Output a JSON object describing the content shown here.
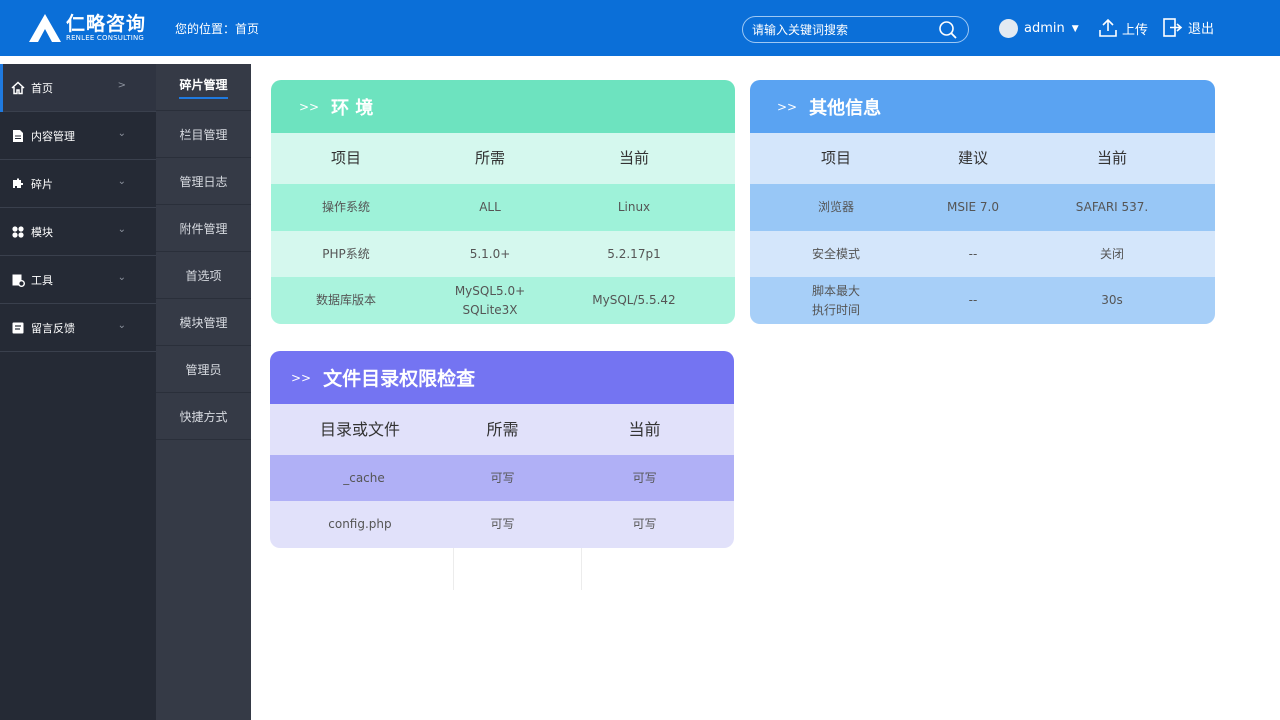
{
  "header": {
    "logo_main": "仁略咨询",
    "logo_sub": "RENLEE CONSULTING",
    "breadcrumb_label": "您的位置：",
    "breadcrumb_page": "首页",
    "search_placeholder": "请输入关键词搜索",
    "username": "admin",
    "upload_label": "上传",
    "logout_label": "退出",
    "brand_color": "#0b6fd8"
  },
  "sidebar": {
    "items": [
      {
        "label": "首页",
        "icon": "home-icon",
        "active": true
      },
      {
        "label": "内容管理",
        "icon": "document-icon"
      },
      {
        "label": "碎片",
        "icon": "puzzle-icon"
      },
      {
        "label": "模块",
        "icon": "modules-icon"
      },
      {
        "label": "工具",
        "icon": "tools-icon"
      },
      {
        "label": "留言反馈",
        "icon": "feedback-icon"
      }
    ]
  },
  "subnav": {
    "items": [
      {
        "label": "碎片管理",
        "active": true
      },
      {
        "label": "栏目管理"
      },
      {
        "label": "管理日志"
      },
      {
        "label": "附件管理"
      },
      {
        "label": "首选项"
      },
      {
        "label": "模块管理"
      },
      {
        "label": "管理员"
      },
      {
        "label": "快捷方式"
      }
    ]
  },
  "env": {
    "marker": ">>",
    "title": "环 境",
    "headers": [
      "项目",
      "所需",
      "当前"
    ],
    "rows": [
      [
        "操作系统",
        "ALL",
        "Linux"
      ],
      [
        "PHP系统",
        "5.1.0+",
        "5.2.17p1"
      ],
      [
        "数据库版本",
        "MySQL5.0+\nSQLite3X",
        "MySQL/5.5.42"
      ]
    ]
  },
  "other": {
    "marker": ">>",
    "title": "其他信息",
    "headers": [
      "项目",
      "建议",
      "当前"
    ],
    "rows": [
      [
        "浏览器",
        "MSIE 7.0",
        "SAFARI 537."
      ],
      [
        "安全模式",
        "--",
        "关闭"
      ],
      [
        "脚本最大\n执行时间",
        "--",
        "30s"
      ]
    ]
  },
  "files": {
    "marker": ">>",
    "title": "文件目录权限检查",
    "headers": [
      "目录或文件",
      "所需",
      "当前"
    ],
    "rows": [
      [
        "_cache",
        "可写",
        "可写"
      ],
      [
        "config.php",
        "可写",
        "可写"
      ]
    ]
  }
}
